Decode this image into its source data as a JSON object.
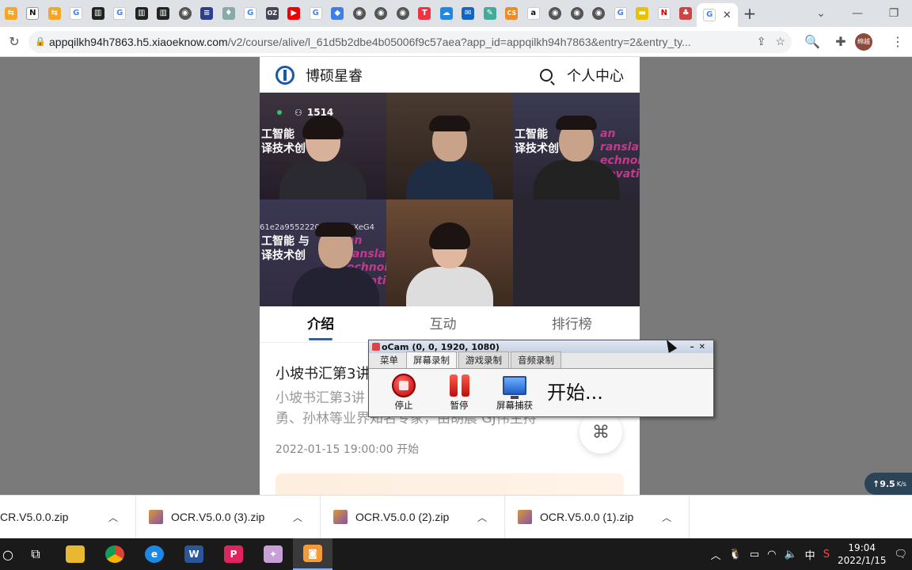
{
  "browser": {
    "url_host": "appqilkh94h7863.h5.xiaoeknow.com",
    "url_path": "/v2/course/alive/l_61d5b2dbe4b05006f9c57aea?app_id=appqilkh94h7863&entry=2&entry_ty...",
    "avatar_text": "绵越",
    "tab_close": "✕"
  },
  "site": {
    "brand": "博硕星睿",
    "profile_link": "个人中心"
  },
  "live": {
    "viewers": "1514",
    "banner_line1": "工智能",
    "banner_line2": "译技术创",
    "banner2_line1": "工智能   与",
    "banner2_line2": "译技术创",
    "session_id": "61e2a95522208_OdgiGXeG4",
    "pink_text": "an\nranslatio\nechnolog\nnovatio"
  },
  "tabs": [
    "介绍",
    "互动",
    "排行榜"
  ],
  "course": {
    "title": "小坡书汇第3讲",
    "desc": "小坡书汇第3讲\n勇、孙林等业界知名专家，由胡晨 GJ伟主持",
    "time": "2022-01-15 19:00:00 开始"
  },
  "ocam": {
    "title": "oCam (0, 0, 1920, 1080)",
    "menu": [
      "菜单",
      "屏幕录制",
      "游戏录制",
      "音频录制"
    ],
    "buttons": [
      "停止",
      "暂停",
      "屏幕捕获"
    ],
    "status": "开始..."
  },
  "net_widget": "9.5",
  "net_unit": "K/s",
  "ime_widget": "中",
  "downloads": [
    "CR.V5.0.0.zip",
    "OCR.V5.0.0 (3).zip",
    "OCR.V5.0.0 (2).zip",
    "OCR.V5.0.0 (1).zip"
  ],
  "taskbar": {
    "time": "19:04",
    "date": "2022/1/15",
    "ime": "中"
  }
}
